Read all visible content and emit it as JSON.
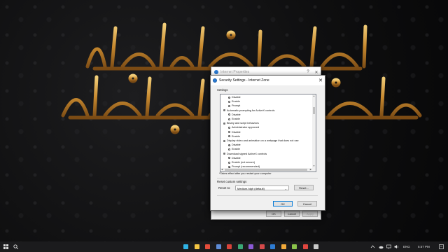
{
  "taskbar": {
    "language": "ENG",
    "clock": "5:57 PM",
    "apps": [
      {
        "name": "Edge",
        "color": "#2fb3e5"
      },
      {
        "name": "Explorer",
        "color": "#f4c542"
      },
      {
        "name": "Chrome",
        "color": "#e44c3a"
      },
      {
        "name": "App4",
        "color": "#5d8bd6"
      },
      {
        "name": "App5",
        "color": "#d8433a"
      },
      {
        "name": "App6",
        "color": "#3aa876"
      },
      {
        "name": "App7",
        "color": "#8b5ad6"
      },
      {
        "name": "App8",
        "color": "#d64a4a"
      },
      {
        "name": "VS Code",
        "color": "#2d7bd2"
      },
      {
        "name": "App10",
        "color": "#f1a93a"
      },
      {
        "name": "App11",
        "color": "#8bc34a"
      },
      {
        "name": "App12",
        "color": "#e0463f"
      },
      {
        "name": "App13",
        "color": "#c9c9c9"
      }
    ]
  },
  "back_dialog": {
    "title": "Internet Properties",
    "help": "?",
    "close": "✕",
    "ok": "OK",
    "cancel": "Cancel",
    "apply": "Apply"
  },
  "dialog": {
    "title": "Security Settings - Internet Zone",
    "close": "✕",
    "settings_label": "Settings",
    "tree_items": [
      {
        "kind": "radio",
        "label": "Disable",
        "checked": true
      },
      {
        "kind": "radio",
        "label": "Enable",
        "checked": false
      },
      {
        "kind": "radio",
        "label": "Prompt",
        "checked": false
      },
      {
        "kind": "group",
        "label": "Automatic prompting for ActiveX controls"
      },
      {
        "kind": "radio",
        "label": "Disable",
        "checked": true
      },
      {
        "kind": "radio",
        "label": "Enable",
        "checked": false
      },
      {
        "kind": "group",
        "label": "Binary and script behaviors"
      },
      {
        "kind": "radio",
        "label": "Administrator approved",
        "checked": false
      },
      {
        "kind": "radio",
        "label": "Disable",
        "checked": false
      },
      {
        "kind": "radio",
        "label": "Enable",
        "checked": true
      },
      {
        "kind": "group",
        "label": "Display video and animation on a webpage that does not use"
      },
      {
        "kind": "radio",
        "label": "Disable",
        "checked": true
      },
      {
        "kind": "radio",
        "label": "Enable",
        "checked": false
      },
      {
        "kind": "group",
        "label": "Download signed ActiveX controls"
      },
      {
        "kind": "radio",
        "label": "Disable",
        "checked": false
      },
      {
        "kind": "radio",
        "label": "Enable (not secure)",
        "checked": false
      },
      {
        "kind": "radio",
        "label": "Prompt (recommended)",
        "checked": true
      }
    ],
    "restart_note": "*Takes effect after you restart your computer",
    "reset_group_label": "Reset custom settings",
    "reset_to_label": "Reset to:",
    "reset_level": "Medium-high (default)",
    "reset_button": "Reset...",
    "ok_button": "OK",
    "cancel_button": "Cancel"
  }
}
